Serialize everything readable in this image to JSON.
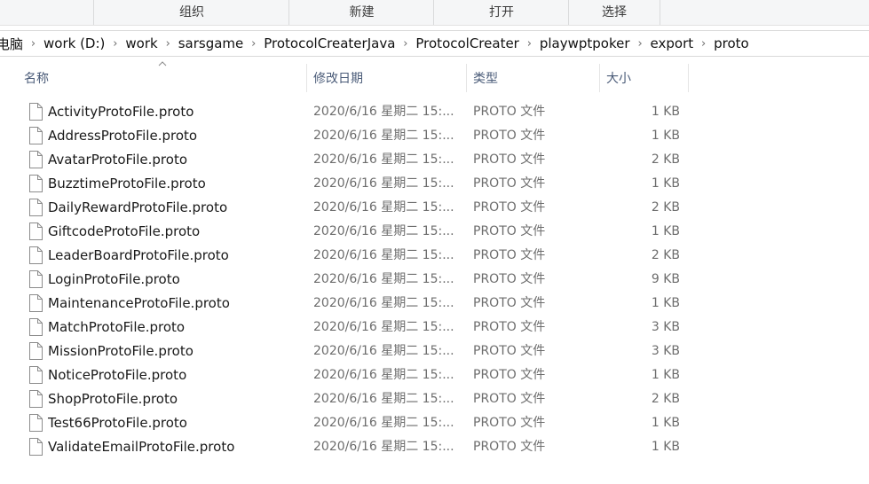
{
  "ribbon": {
    "groups": [
      "组织",
      "新建",
      "打开",
      "选择"
    ]
  },
  "breadcrumb": {
    "items": [
      "电脑",
      "work (D:)",
      "work",
      "sarsgame",
      "ProtocolCreaterJava",
      "ProtocolCreater",
      "playwptpoker",
      "export",
      "proto"
    ],
    "separator": "›"
  },
  "columns": {
    "name": "名称",
    "modified": "修改日期",
    "type": "类型",
    "size": "大小"
  },
  "files": [
    {
      "name": "ActivityProtoFile.proto",
      "modified": "2020/6/16 星期二 15:...",
      "type": "PROTO 文件",
      "size": "1 KB"
    },
    {
      "name": "AddressProtoFile.proto",
      "modified": "2020/6/16 星期二 15:...",
      "type": "PROTO 文件",
      "size": "1 KB"
    },
    {
      "name": "AvatarProtoFile.proto",
      "modified": "2020/6/16 星期二 15:...",
      "type": "PROTO 文件",
      "size": "2 KB"
    },
    {
      "name": "BuzztimeProtoFile.proto",
      "modified": "2020/6/16 星期二 15:...",
      "type": "PROTO 文件",
      "size": "1 KB"
    },
    {
      "name": "DailyRewardProtoFile.proto",
      "modified": "2020/6/16 星期二 15:...",
      "type": "PROTO 文件",
      "size": "2 KB"
    },
    {
      "name": "GiftcodeProtoFile.proto",
      "modified": "2020/6/16 星期二 15:...",
      "type": "PROTO 文件",
      "size": "1 KB"
    },
    {
      "name": "LeaderBoardProtoFile.proto",
      "modified": "2020/6/16 星期二 15:...",
      "type": "PROTO 文件",
      "size": "2 KB"
    },
    {
      "name": "LoginProtoFile.proto",
      "modified": "2020/6/16 星期二 15:...",
      "type": "PROTO 文件",
      "size": "9 KB"
    },
    {
      "name": "MaintenanceProtoFile.proto",
      "modified": "2020/6/16 星期二 15:...",
      "type": "PROTO 文件",
      "size": "1 KB"
    },
    {
      "name": "MatchProtoFile.proto",
      "modified": "2020/6/16 星期二 15:...",
      "type": "PROTO 文件",
      "size": "3 KB"
    },
    {
      "name": "MissionProtoFile.proto",
      "modified": "2020/6/16 星期二 15:...",
      "type": "PROTO 文件",
      "size": "3 KB"
    },
    {
      "name": "NoticeProtoFile.proto",
      "modified": "2020/6/16 星期二 15:...",
      "type": "PROTO 文件",
      "size": "1 KB"
    },
    {
      "name": "ShopProtoFile.proto",
      "modified": "2020/6/16 星期二 15:...",
      "type": "PROTO 文件",
      "size": "2 KB"
    },
    {
      "name": "Test66ProtoFile.proto",
      "modified": "2020/6/16 星期二 15:...",
      "type": "PROTO 文件",
      "size": "1 KB"
    },
    {
      "name": "ValidateEmailProtoFile.proto",
      "modified": "2020/6/16 星期二 15:...",
      "type": "PROTO 文件",
      "size": "1 KB"
    }
  ]
}
